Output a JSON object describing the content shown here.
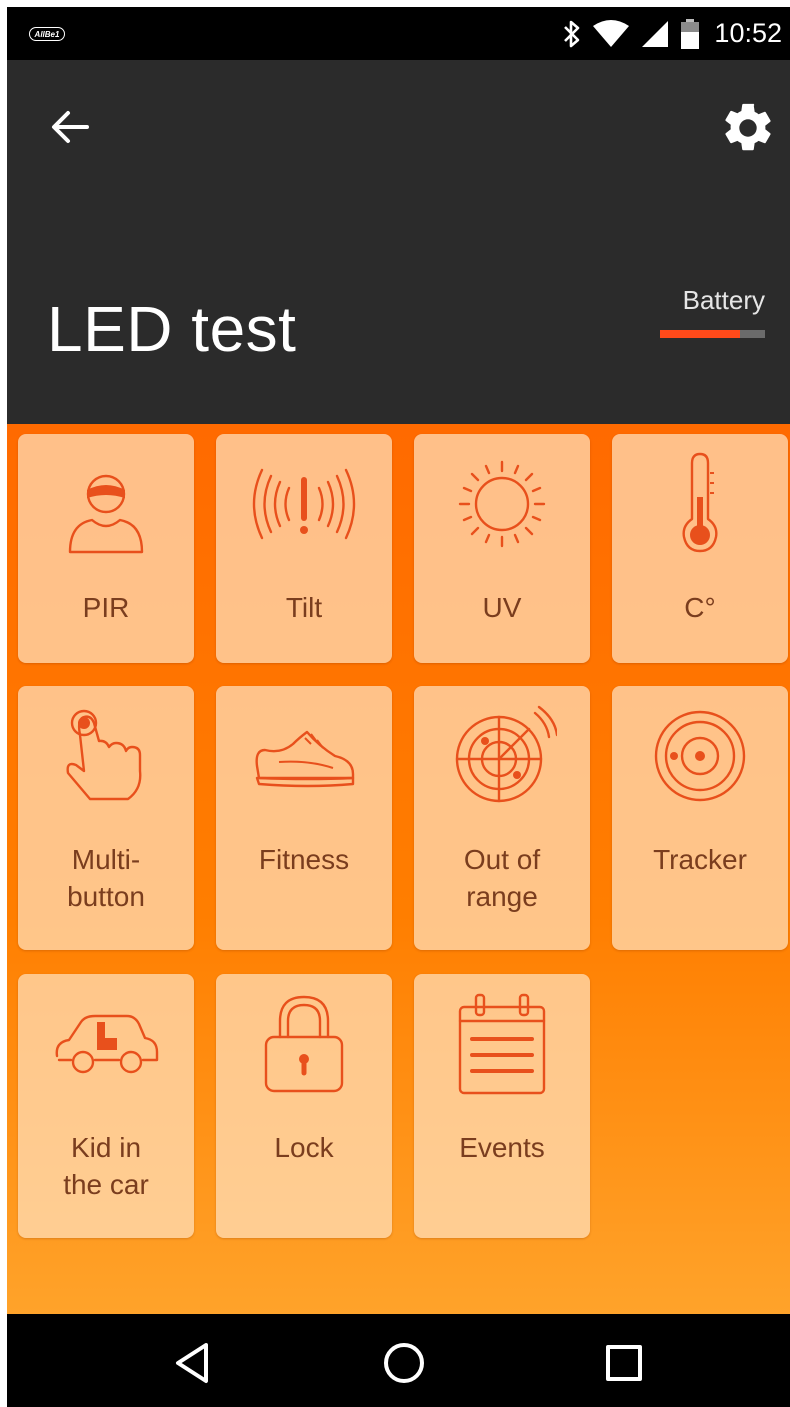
{
  "status_bar": {
    "carrier": "AllBe1",
    "time": "10:52",
    "icons": [
      "bluetooth-icon",
      "wifi-icon",
      "signal-icon",
      "battery-icon"
    ]
  },
  "app_bar": {
    "title": "LED test",
    "battery_label": "Battery",
    "battery_level_percent": 76,
    "back_icon": "arrow-left-icon",
    "settings_icon": "gear-icon"
  },
  "tiles": [
    {
      "id": "pir",
      "label": "PIR",
      "icon": "masked-person-icon"
    },
    {
      "id": "tilt",
      "label": "Tilt",
      "icon": "vibration-alert-icon"
    },
    {
      "id": "uv",
      "label": "UV",
      "icon": "sun-icon"
    },
    {
      "id": "temperature",
      "label": "C°",
      "icon": "thermometer-icon"
    },
    {
      "id": "multi-button",
      "label": "Multi-\nbutton",
      "icon": "finger-press-icon"
    },
    {
      "id": "fitness",
      "label": "Fitness",
      "icon": "sneaker-icon"
    },
    {
      "id": "out-of-range",
      "label": "Out of\nrange",
      "icon": "radar-icon"
    },
    {
      "id": "tracker",
      "label": "Tracker",
      "icon": "target-icon"
    },
    {
      "id": "kid-in-car",
      "label": "Kid in\nthe car",
      "icon": "car-child-seat-icon"
    },
    {
      "id": "lock",
      "label": "Lock",
      "icon": "padlock-icon"
    },
    {
      "id": "events",
      "label": "Events",
      "icon": "calendar-icon"
    }
  ],
  "nav_bar": {
    "back_icon": "triangle-back-icon",
    "home_icon": "circle-home-icon",
    "recents_icon": "square-recents-icon"
  },
  "colors": {
    "app_bar_bg": "#2b2b2b",
    "accent": "#ff4a1a",
    "content_top": "#ff6a00",
    "content_bottom": "#ffa32a",
    "icon_stroke": "#e8501c",
    "tile_label": "#7a3d1e"
  }
}
